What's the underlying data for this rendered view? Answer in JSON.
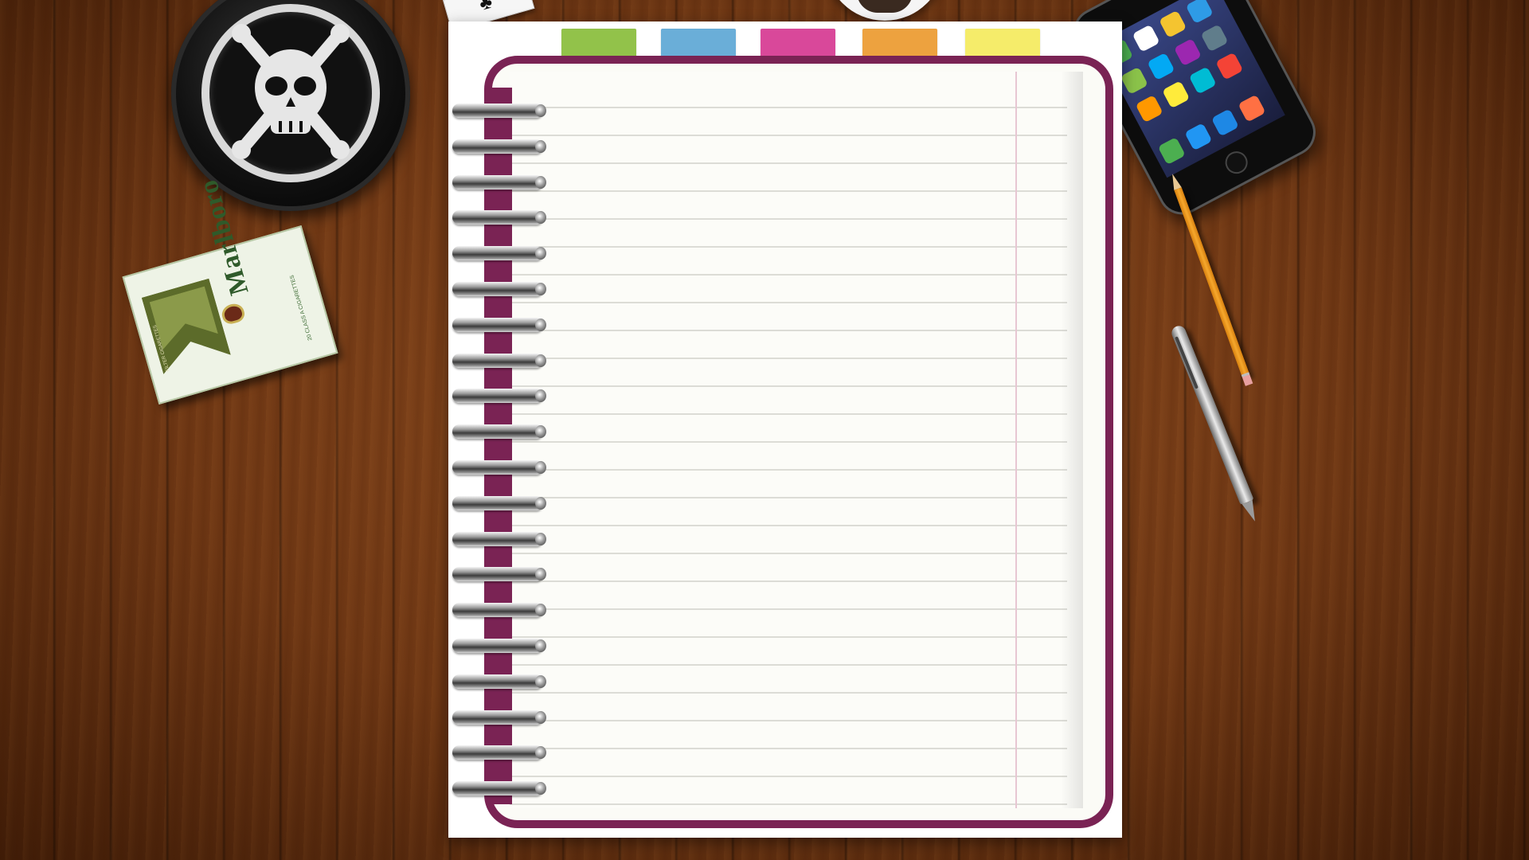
{
  "scene": {
    "background": "wood-desk",
    "notebook": {
      "cover_color": "#7a2354",
      "page_color": "#fcfcf8",
      "margin_line_color": "#e7c6d2",
      "ruled_line_count": 26,
      "ring_count": 20,
      "tabs": [
        {
          "name": "tab-green",
          "color": "#92c24a"
        },
        {
          "name": "tab-blue",
          "color": "#6aaed8"
        },
        {
          "name": "tab-pink",
          "color": "#d9489a"
        },
        {
          "name": "tab-orange",
          "color": "#eda23f"
        },
        {
          "name": "tab-yellow",
          "color": "#f5ec6a"
        }
      ]
    },
    "cigarette_pack": {
      "brand": "Marlboro",
      "subtitle": "20 CLASS A CIGARETTES",
      "side_label": "FILTER CIGARETTES"
    },
    "icons": {
      "ashtray": "skull-crossbones-icon",
      "phone": "smartphone-icon",
      "pencil": "pencil-icon",
      "pen": "pen-icon",
      "card": "playing-card-icon",
      "cup": "coffee-cup-icon"
    }
  }
}
